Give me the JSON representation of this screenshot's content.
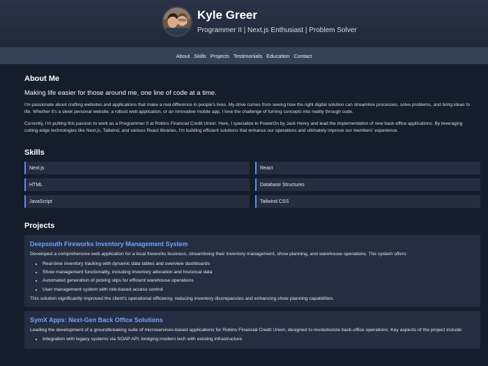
{
  "header": {
    "name": "Kyle Greer",
    "tagline": "Programmer II | Next.js Enthusiast | Problem Solver"
  },
  "nav": {
    "items": [
      "About",
      "Skills",
      "Projects",
      "Testimonials",
      "Education",
      "Contact"
    ]
  },
  "about": {
    "title": "About Me",
    "lead": "Making life easier for those around me, one line of code at a time.",
    "paragraphs": [
      "I'm passionate about crafting websites and applications that make a real difference in people's lives. My drive comes from seeing how the right digital solution can streamline processes, solve problems, and bring ideas to life. Whether it's a sleek personal website, a robust web application, or an innovative mobile app, I love the challenge of turning concepts into reality through code.",
      "Currently, I'm putting this passion to work as a Programmer II at Robins Financial Credit Union. Here, I specialize in PowerOn by Jack Henry and lead the implementation of new back-office applications. By leveraging cutting-edge technologies like Next.js, Tailwind, and various React libraries, I'm building efficient solutions that enhance our operations and ultimately improve our members' experience."
    ]
  },
  "skills": {
    "title": "Skills",
    "items": [
      "Next.js",
      "React",
      "HTML",
      "Database Structures",
      "JavaScript",
      "Tailwind CSS"
    ]
  },
  "projects": {
    "title": "Projects",
    "items": [
      {
        "title": "Deepsouth Fireworks Inventory Management System",
        "desc": "Developed a comprehensive web application for a local fireworks business, streamlining their inventory management, show planning, and warehouse operations. The system offers:",
        "bullets": [
          "Real-time inventory tracking with dynamic data tables and overview dashboards",
          "Show management functionality, including inventory allocation and historical data",
          "Automated generation of picking slips for efficient warehouse operations",
          "User management system with role-based access control"
        ],
        "foot": "This solution significantly improved the client's operational efficiency, reducing inventory discrepancies and enhancing show planning capabilities."
      },
      {
        "title": "SymX Apps: Next-Gen Back Office Solutions",
        "desc": "Leading the development of a groundbreaking suite of microservices-based applications for Robins Financial Credit Union, designed to revolutionize back-office operations. Key aspects of the project include:",
        "bullets": [
          "Integration with legacy systems via SOAP API, bridging modern tech with existing infrastructure"
        ],
        "foot": ""
      }
    ]
  },
  "colors": {
    "background": "#151c2c",
    "card": "#252e40",
    "accent": "#5b8def",
    "link": "#6fa3ff"
  },
  "icons": {
    "avatar": "profile-photo"
  }
}
